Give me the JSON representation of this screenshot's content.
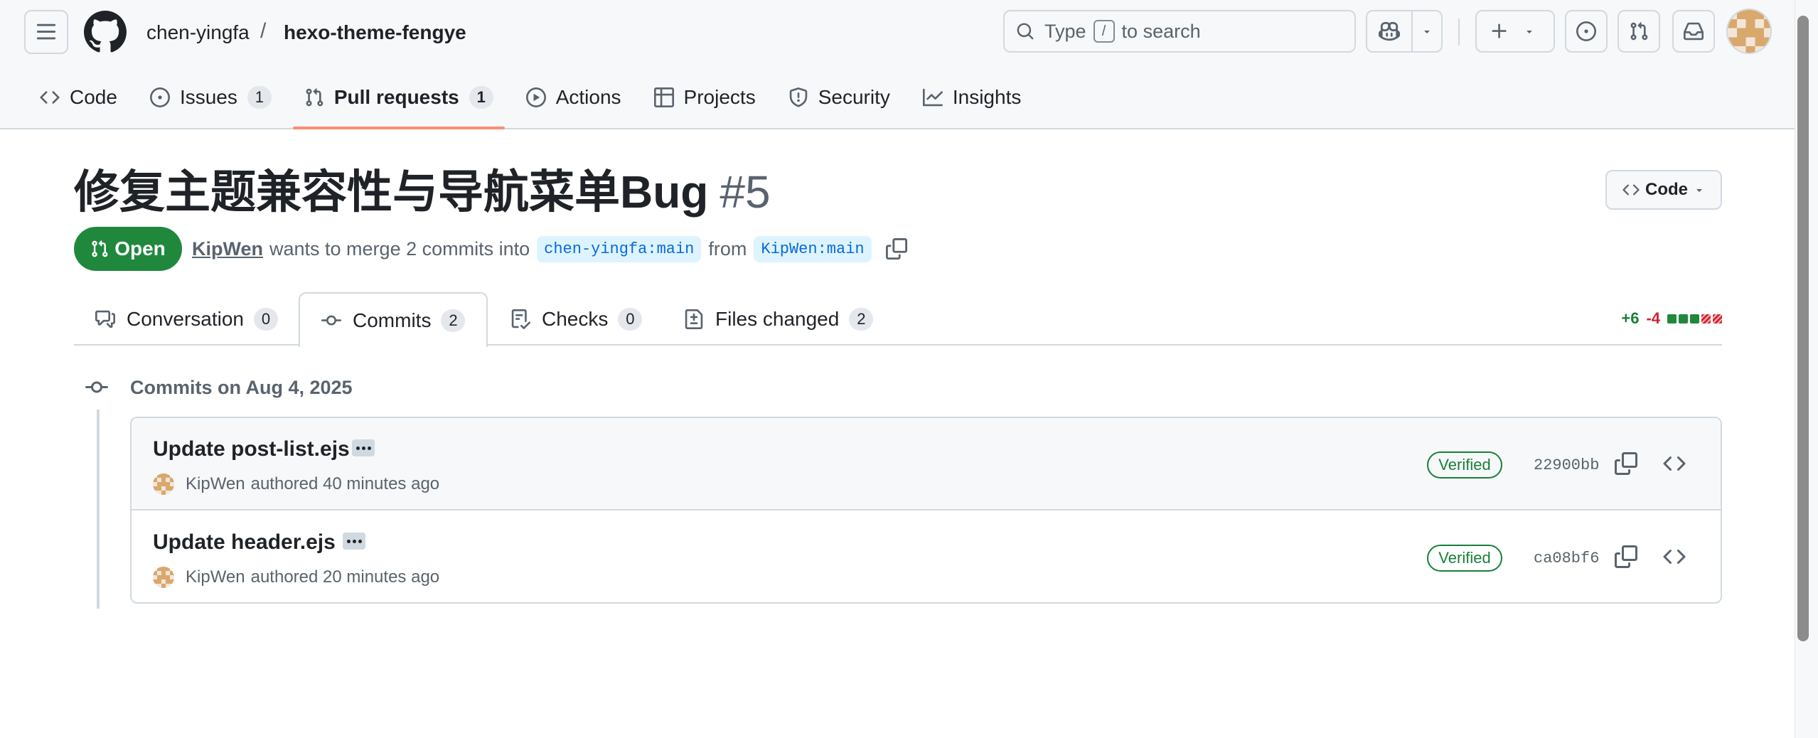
{
  "header": {
    "owner": "chen-yingfa",
    "separator": "/",
    "repo": "hexo-theme-fengye",
    "search_type": "Type",
    "search_key": "/",
    "search_suffix": "to search"
  },
  "repo_nav": {
    "code": "Code",
    "issues": "Issues",
    "issues_count": "1",
    "pulls": "Pull requests",
    "pulls_count": "1",
    "actions": "Actions",
    "projects": "Projects",
    "security": "Security",
    "insights": "Insights"
  },
  "pr": {
    "title": "修复主题兼容性与导航菜单Bug",
    "number": "#5",
    "code_button": "Code",
    "state": "Open",
    "author": "KipWen",
    "merge_text": "wants to merge 2 commits into",
    "base_branch": "chen-yingfa:main",
    "from_text": "from",
    "head_branch": "KipWen:main"
  },
  "tabs": {
    "conversation": "Conversation",
    "conversation_count": "0",
    "commits": "Commits",
    "commits_count": "2",
    "checks": "Checks",
    "checks_count": "0",
    "files": "Files changed",
    "files_count": "2"
  },
  "diffstat": {
    "additions": "+6",
    "deletions": "-4",
    "blocks": [
      "added",
      "added",
      "added",
      "deleted",
      "deleted"
    ]
  },
  "commits": {
    "day_heading": "Commits on Aug 4, 2025",
    "items": [
      {
        "message": "Update post-list.ejs",
        "author": "KipWen",
        "authored_text": "authored 40 minutes ago",
        "verified": "Verified",
        "sha": "22900bb"
      },
      {
        "message": "Update header.ejs",
        "author": "KipWen",
        "authored_text": "authored 20 minutes ago",
        "verified": "Verified",
        "sha": "ca08bf6"
      }
    ]
  },
  "colors": {
    "open_green": "#1f883d",
    "verified_green": "#1a7f37",
    "deletion_red": "#d1242f",
    "selected_underline": "#fd8c73",
    "branch_blue": "#0969da"
  }
}
